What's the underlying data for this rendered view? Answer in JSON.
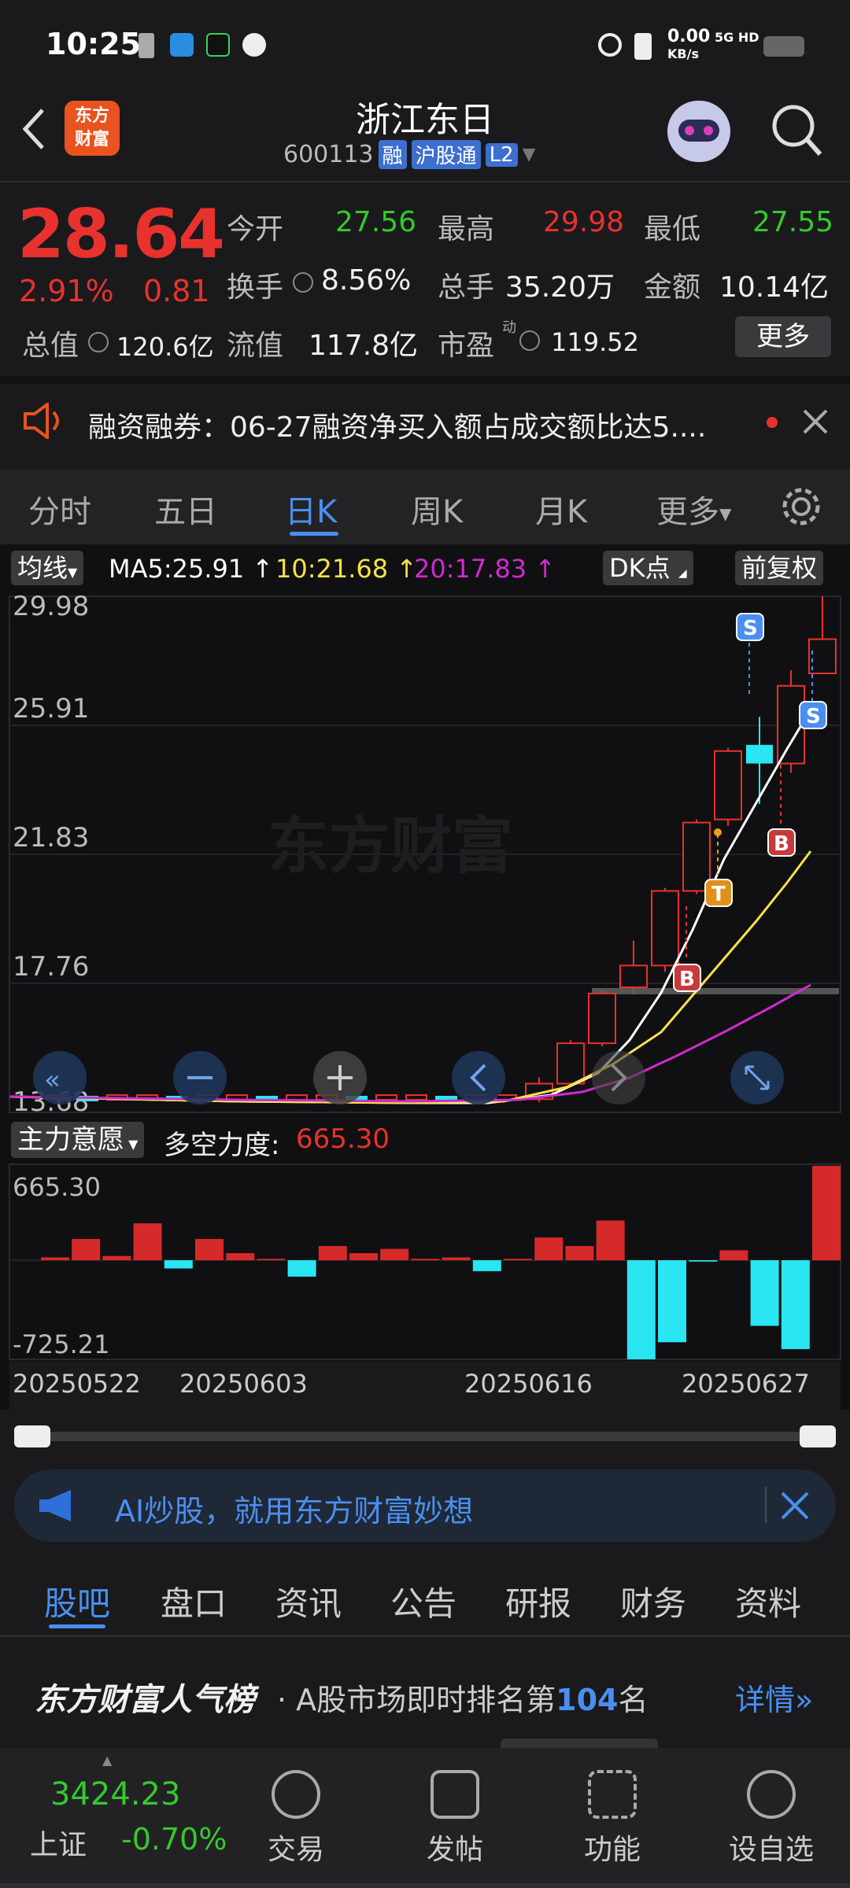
{
  "status": {
    "time": "10:25",
    "net_speed": "0.00",
    "net_unit": "KB/s",
    "net_type": "5G HD"
  },
  "header": {
    "logo_line1": "东方",
    "logo_line2": "财富",
    "title": "浙江东日",
    "code": "600113",
    "tag_margin": "融",
    "tag_connect": "沪股通",
    "tag_level": "L2"
  },
  "quote": {
    "price": "28.64",
    "change_pct": "2.91%",
    "change_amt": "0.81",
    "open_label": "今开",
    "open": "27.56",
    "high_label": "最高",
    "high": "29.98",
    "low_label": "最低",
    "low": "27.55",
    "turnover_label": "换手",
    "turnover": "8.56%",
    "volume_label": "总手",
    "volume": "35.20万",
    "amount_label": "金额",
    "amount": "10.14亿",
    "mcap_label": "总值",
    "mcap": "120.6亿",
    "float_label": "流值",
    "float": "117.8亿",
    "pe_label": "市盈",
    "pe_sup": "动",
    "pe": "119.52",
    "more": "更多"
  },
  "notice": {
    "text": "融资融券：06-27融资净买入额占成交额比达5...."
  },
  "tabs": [
    "分时",
    "五日",
    "日K",
    "周K",
    "月K",
    "更多"
  ],
  "active_tab": "日K",
  "chart": {
    "ma_label": "均线",
    "ma5": "MA5:25.91",
    "ma10": "10:21.68",
    "ma20": "20:17.83",
    "dk_label": "DK点",
    "fq_label": "前复权",
    "y_labels": [
      "29.98",
      "25.91",
      "21.83",
      "17.76",
      "13.68"
    ],
    "watermark": "东方财富",
    "indicator_label": "主力意愿",
    "indicator_name": "多空力度:",
    "indicator_value": "665.30",
    "ind_top": "665.30",
    "ind_bottom": "-725.21",
    "dates": [
      "20250522",
      "20250603",
      "20250616",
      "20250627"
    ],
    "colors": {
      "up": "#e8322e",
      "down": "#29e6f2",
      "ma5": "#ffffff",
      "ma10": "#f5e14a",
      "ma20": "#d02ad0"
    }
  },
  "chart_data": [
    {
      "type": "candlestick",
      "ylim": [
        13.68,
        29.98
      ],
      "candles_recent": [
        {
          "o": 13.8,
          "c": 14.3,
          "h": 14.5,
          "l": 13.7
        },
        {
          "o": 14.3,
          "c": 15.6,
          "h": 15.7,
          "l": 14.2
        },
        {
          "o": 15.6,
          "c": 17.2,
          "h": 17.3,
          "l": 15.5
        },
        {
          "o": 17.4,
          "c": 18.1,
          "h": 18.9,
          "l": 17.2
        },
        {
          "o": 18.1,
          "c": 20.5,
          "h": 20.6,
          "l": 17.9
        },
        {
          "o": 20.5,
          "c": 22.7,
          "h": 22.8,
          "l": 20.4
        },
        {
          "o": 22.8,
          "c": 25.0,
          "h": 25.1,
          "l": 22.6
        },
        {
          "o": 25.2,
          "c": 24.6,
          "h": 26.1,
          "l": 23.3
        },
        {
          "o": 24.6,
          "c": 27.1,
          "h": 27.6,
          "l": 24.3
        },
        {
          "o": 27.5,
          "c": 28.6,
          "h": 29.98,
          "l": 27.5
        }
      ]
    },
    {
      "type": "bar",
      "name": "多空力度",
      "ylim": [
        -725.21,
        665.3
      ],
      "values": [
        20,
        150,
        30,
        260,
        -60,
        150,
        50,
        10,
        -120,
        100,
        50,
        80,
        10,
        20,
        -80,
        10,
        160,
        100,
        280,
        -725,
        -600,
        -10,
        70,
        -480,
        -650,
        665
      ]
    }
  ],
  "ai_banner": {
    "text": "AI炒股，就用东方财富妙想"
  },
  "bottom_tabs": [
    "股吧",
    "盘口",
    "资讯",
    "公告",
    "研报",
    "财务",
    "资料"
  ],
  "popular": {
    "brand": "东方财富人气榜",
    "text_pre": "· A股市场即时排名第",
    "rank": "104",
    "text_post": "名",
    "detail": "详情"
  },
  "nav": {
    "index_value": "3424.23",
    "index_name": "上证",
    "index_change": "-0.70%",
    "items": [
      "交易",
      "发帖",
      "功能",
      "设自选"
    ]
  }
}
